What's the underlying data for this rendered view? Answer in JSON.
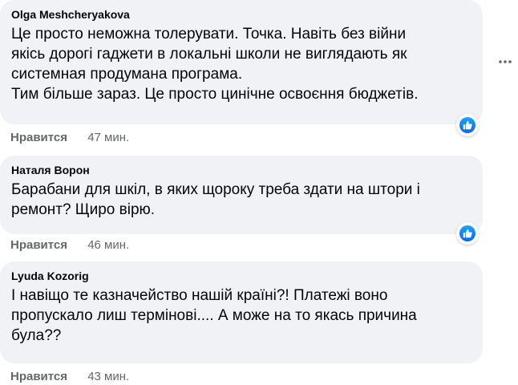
{
  "comments": [
    {
      "author": "Olga Meshcheryakova",
      "lines": [
        "Це просто неможна толерувати. Точка. Навіть без війни",
        "якісь дорогі гаджети в локальні школи не виглядають як",
        "системная продумана програма.",
        "Тим більше зараз. Це просто цинічне освоєння бюджетів."
      ],
      "like_label": "Нравится",
      "time": "47 мин."
    },
    {
      "author": "Наталя Ворон",
      "lines": [
        "Барабани для шкіл, в яких щороку треба здати на штори і",
        "ремонт? Щиро вірю."
      ],
      "like_label": "Нравится",
      "time": "46 мин."
    },
    {
      "author": "Lyuda Kozorig",
      "lines": [
        "І навіщо те казначейство нашій країні?! Платежі воно",
        "пропускало лиш термінові.... А може на то якась причина",
        "була??"
      ],
      "like_label": "Нравится",
      "time": "43 мин."
    }
  ],
  "icons": {
    "more": "more-horizontal-icon",
    "like_badge": "thumbs-up-icon"
  },
  "colors": {
    "bubble": "#f0f2f5",
    "meta": "#65676b",
    "like_blue": "#1877f2"
  }
}
